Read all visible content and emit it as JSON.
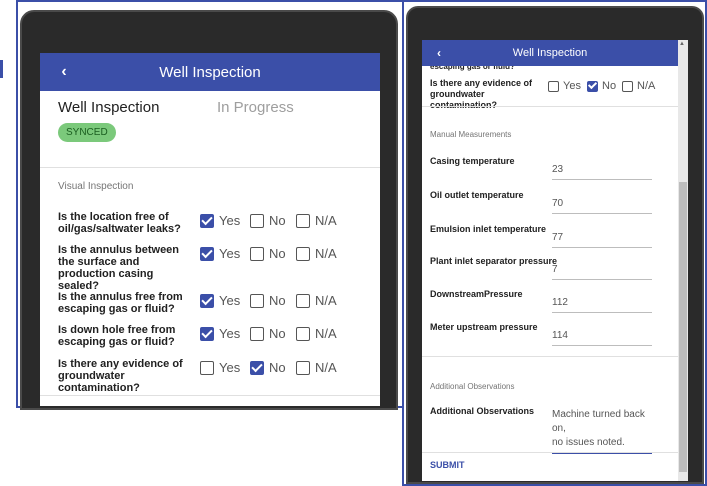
{
  "left": {
    "header": {
      "back_icon": "chevron-left-icon",
      "title": "Well Inspection"
    },
    "card": {
      "title": "Well Inspection",
      "status": "In Progress",
      "badge": "SYNCED"
    },
    "section": "Visual Inspection",
    "options": {
      "yes": "Yes",
      "no": "No",
      "na": "N/A"
    },
    "questions": [
      {
        "text": "Is the location free of oil/gas/saltwater leaks?",
        "answer": "Yes"
      },
      {
        "text": "Is the annulus between the surface and production casing sealed?",
        "answer": "Yes"
      },
      {
        "text": "Is the annulus free from escaping gas or fluid?",
        "answer": "Yes"
      },
      {
        "text": "Is down hole free from escaping gas or fluid?",
        "answer": "Yes"
      },
      {
        "text": "Is there any evidence of groundwater contamination?",
        "answer": "No"
      }
    ]
  },
  "right": {
    "header": {
      "back_icon": "chevron-left-icon",
      "title": "Well Inspection"
    },
    "partial_question": "escaping gas or fluid?",
    "question": {
      "text": "Is there any evidence of groundwater contamination?",
      "answer": "No"
    },
    "options": {
      "yes": "Yes",
      "no": "No",
      "na": "N/A"
    },
    "manual_section": "Manual Measurements",
    "measurements": [
      {
        "label": "Casing temperature",
        "value": "23"
      },
      {
        "label": "Oil outlet temperature",
        "value": "70"
      },
      {
        "label": "Emulsion inlet temperature",
        "value": "77"
      },
      {
        "label": "Plant inlet separator pressure",
        "value": "7"
      },
      {
        "label": "DownstreamPressure",
        "value": "112"
      },
      {
        "label": "Meter upstream pressure",
        "value": "114"
      }
    ],
    "observations_section": "Additional Observations",
    "observations_label": "Additional Observations",
    "observations_value_line1": "Machine turned back on,",
    "observations_value_line2": "no issues noted.",
    "submit": "SUBMIT"
  },
  "colors": {
    "primary": "#3b4fa8",
    "synced_badge": "#7bc97b",
    "device_bezel": "#2a2a2a"
  }
}
